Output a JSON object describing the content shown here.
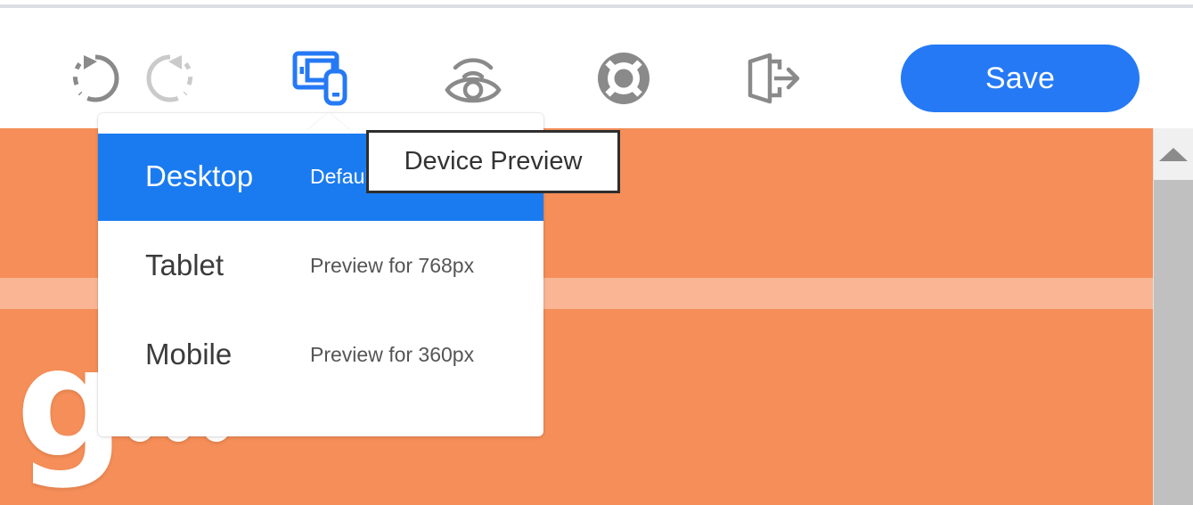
{
  "app": {
    "title": "Device Preview",
    "accent_color": "#2579f5",
    "canvas_color": "#f58e58",
    "canvas_band_color": "#fab694",
    "highlight_color": "#1a7bf0"
  },
  "toolbar": {
    "buttons": [
      {
        "name": "undo",
        "label": "Undo",
        "icon": "undo-icon",
        "state": "enabled",
        "color": "#8a8a8a"
      },
      {
        "name": "redo",
        "label": "Redo",
        "icon": "redo-icon",
        "state": "disabled",
        "color": "#c9c9c9"
      },
      {
        "name": "device-preview",
        "label": "Device Preview",
        "icon": "device-preview-icon",
        "state": "active",
        "color": "#2579f5"
      },
      {
        "name": "live-preview",
        "label": "Preview",
        "icon": "eye-preview-icon",
        "state": "enabled",
        "color": "#8a8a8a"
      },
      {
        "name": "help",
        "label": "Help",
        "icon": "lifebuoy-icon",
        "state": "enabled",
        "color": "#8a8a8a"
      },
      {
        "name": "exit",
        "label": "Exit",
        "icon": "exit-door-icon",
        "state": "enabled",
        "color": "#8a8a8a"
      }
    ],
    "save_label": "Save"
  },
  "tooltip": {
    "text": "Device Preview"
  },
  "device_menu": {
    "items": [
      {
        "title": "Desktop",
        "description": "Default view",
        "selected": true
      },
      {
        "title": "Tablet",
        "description": "Preview for 768px",
        "selected": false
      },
      {
        "title": "Mobile",
        "description": "Preview for 360px",
        "selected": false
      }
    ]
  },
  "canvas": {
    "logo_letter": "g",
    "logo_dots": 3
  },
  "scrollbar": {
    "up_arrow": "scroll-up-arrow-icon",
    "position": "top"
  }
}
